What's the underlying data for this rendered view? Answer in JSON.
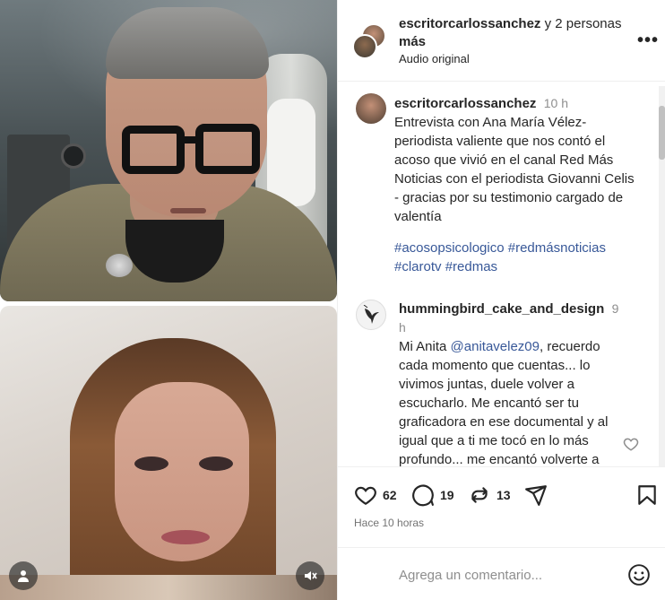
{
  "post": {
    "author": "escritorcarlossanchez",
    "coauthors_text": "y 2 personas",
    "title_tail": "más",
    "audio": "Audio original",
    "more_icon": "more-horizontal-icon"
  },
  "comments": [
    {
      "username": "escritorcarlossanchez",
      "time": "10 h",
      "text": "Entrevista con Ana María Vélez- periodista valiente que nos contó el acoso que vivió en el canal Red Más Noticias con el periodista Giovanni Celis - gracias por su testimonio cargado de valentía",
      "hashtags": "#acosopsicologico #redmásnoticias #clarotv #redmas"
    },
    {
      "username": "hummingbird_cake_and_design",
      "time": "9 h",
      "prefix": "Mi Anita ",
      "mention": "@anitavelez09",
      "text": ", recuerdo cada momento que cuentas... lo vivimos juntas, duele volver a escucharlo. Me encantó ser tu graficadora en ese documental y al igual que a ti me tocó en lo más profundo... me encantó volverte a"
    }
  ],
  "actions": {
    "likes": "62",
    "comments": "19",
    "reposts": "13",
    "time_ago": "Hace 10 horas"
  },
  "add_comment": {
    "placeholder": "Agrega un comentario..."
  },
  "colors": {
    "link": "#385898",
    "muted": "#8e8e8e",
    "text": "#262626"
  }
}
